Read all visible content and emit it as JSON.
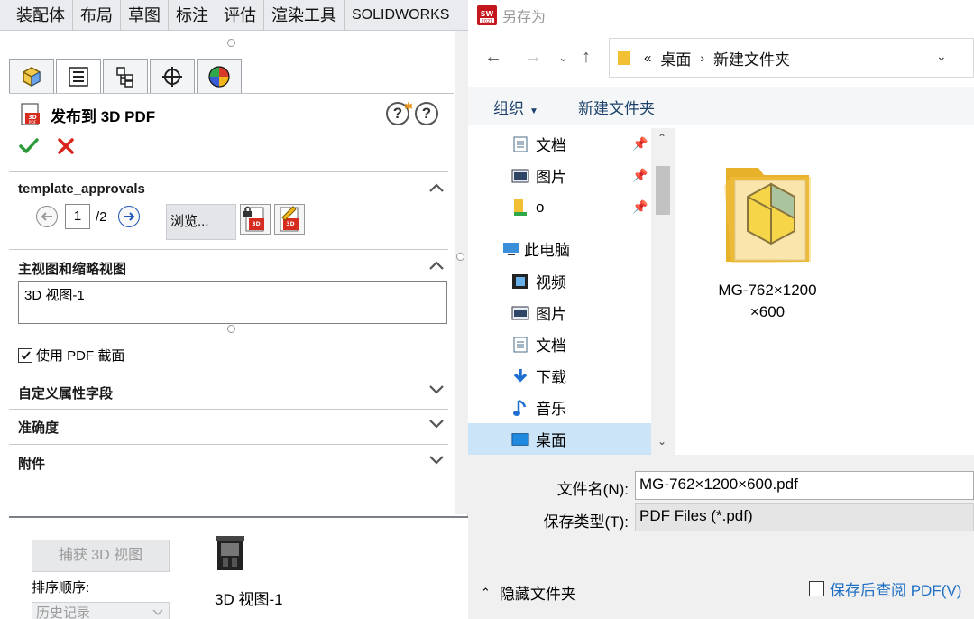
{
  "cm_tabs": [
    "装配体",
    "布局",
    "草图",
    "标注",
    "评估",
    "渲染工具",
    "SOLIDWORKS"
  ],
  "fm_tabs": [
    {
      "name": "feature-manager-icon"
    },
    {
      "name": "property-manager-icon"
    },
    {
      "name": "configuration-manager-icon"
    },
    {
      "name": "dimxpert-icon"
    },
    {
      "name": "display-manager-icon"
    }
  ],
  "pm": {
    "title": "发布到 3D PDF",
    "help_icons": [
      "?",
      "?"
    ],
    "template_section": "template_approvals",
    "page_current": "1",
    "page_total": "/2",
    "browse_label": "浏览...",
    "views_section": "主视图和缩略视图",
    "views_list": [
      "3D 视图-1"
    ],
    "use_pdf_checkbox": "使用 PDF 截面",
    "use_pdf_checked": true,
    "custom_props_section": "自定义属性字段",
    "accuracy_section": "准确度",
    "attachments_section": "附件"
  },
  "bottom": {
    "capture_button": "捕获 3D 视图",
    "sort_label": "排序顺序:",
    "sort_value": "历史记录",
    "view_item_label": "3D 视图-1"
  },
  "dialog": {
    "title": "另存为",
    "breadcrumb_overflow": "«",
    "breadcrumb": [
      "桌面",
      "新建文件夹"
    ],
    "toolbar_organize": "组织",
    "toolbar_new_folder": "新建文件夹",
    "nav_items": [
      {
        "label": "文档",
        "icon": "document-icon",
        "pinned": true
      },
      {
        "label": "图片",
        "icon": "picture-icon",
        "pinned": true
      },
      {
        "label": "o",
        "icon": "folder-icon",
        "pinned": true
      },
      {
        "label": "此电脑",
        "icon": "computer-icon",
        "pinned": false
      },
      {
        "label": "视频",
        "icon": "video-icon",
        "pinned": false
      },
      {
        "label": "图片",
        "icon": "picture-icon",
        "pinned": false
      },
      {
        "label": "文档",
        "icon": "document-icon",
        "pinned": false
      },
      {
        "label": "下载",
        "icon": "download-icon",
        "pinned": false
      },
      {
        "label": "音乐",
        "icon": "music-icon",
        "pinned": false
      },
      {
        "label": "桌面",
        "icon": "desktop-icon",
        "pinned": false,
        "selected": true
      }
    ],
    "folder_name": "MG-762×1200×600",
    "folder_name_line1": "MG-762×1200",
    "folder_name_line2": "×600",
    "filename_label": "文件名(N):",
    "filename_value": "MG-762×1200×600.pdf",
    "filetype_label": "保存类型(T):",
    "filetype_value": "PDF Files (*.pdf)",
    "hide_folders": "隐藏文件夹",
    "view_after_save": "保存后查阅 PDF(V)",
    "view_after_save_checked": false
  },
  "colors": {
    "accent": "#1e6fc4",
    "selection": "#cce4f7",
    "ok_green": "#2d9a3a",
    "cancel_red": "#d8241c"
  }
}
